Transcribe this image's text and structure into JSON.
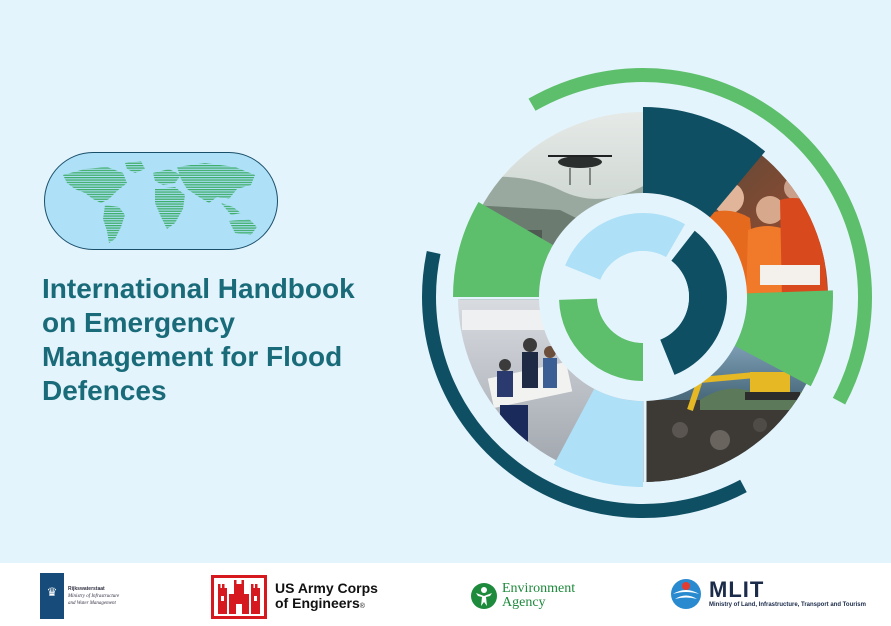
{
  "cover": {
    "title": "International Handbook on Emergency Management for Flood Defences",
    "colors": {
      "background": "#e4f4fc",
      "title": "#1a6b7a",
      "dark_teal": "#0f4f63",
      "green": "#5dbf6b",
      "light_blue": "#aee0f7"
    },
    "photos": [
      "helicopter-flood-icon",
      "rescue-workers-icon",
      "control-room-icon",
      "excavator-coast-icon"
    ]
  },
  "logos": {
    "rijkswaterstaat": {
      "name": "Rijkswaterstaat",
      "line1": "Ministry of Infrastructure",
      "line2": "and Water Management"
    },
    "usace": {
      "line1": "US Army Corps",
      "line2": "of Engineers",
      "mark": "®"
    },
    "environment_agency": {
      "line1": "Environment",
      "line2": "Agency"
    },
    "mlit": {
      "name": "MLIT",
      "subtitle": "Ministry of Land, Infrastructure, Transport and Tourism"
    }
  }
}
